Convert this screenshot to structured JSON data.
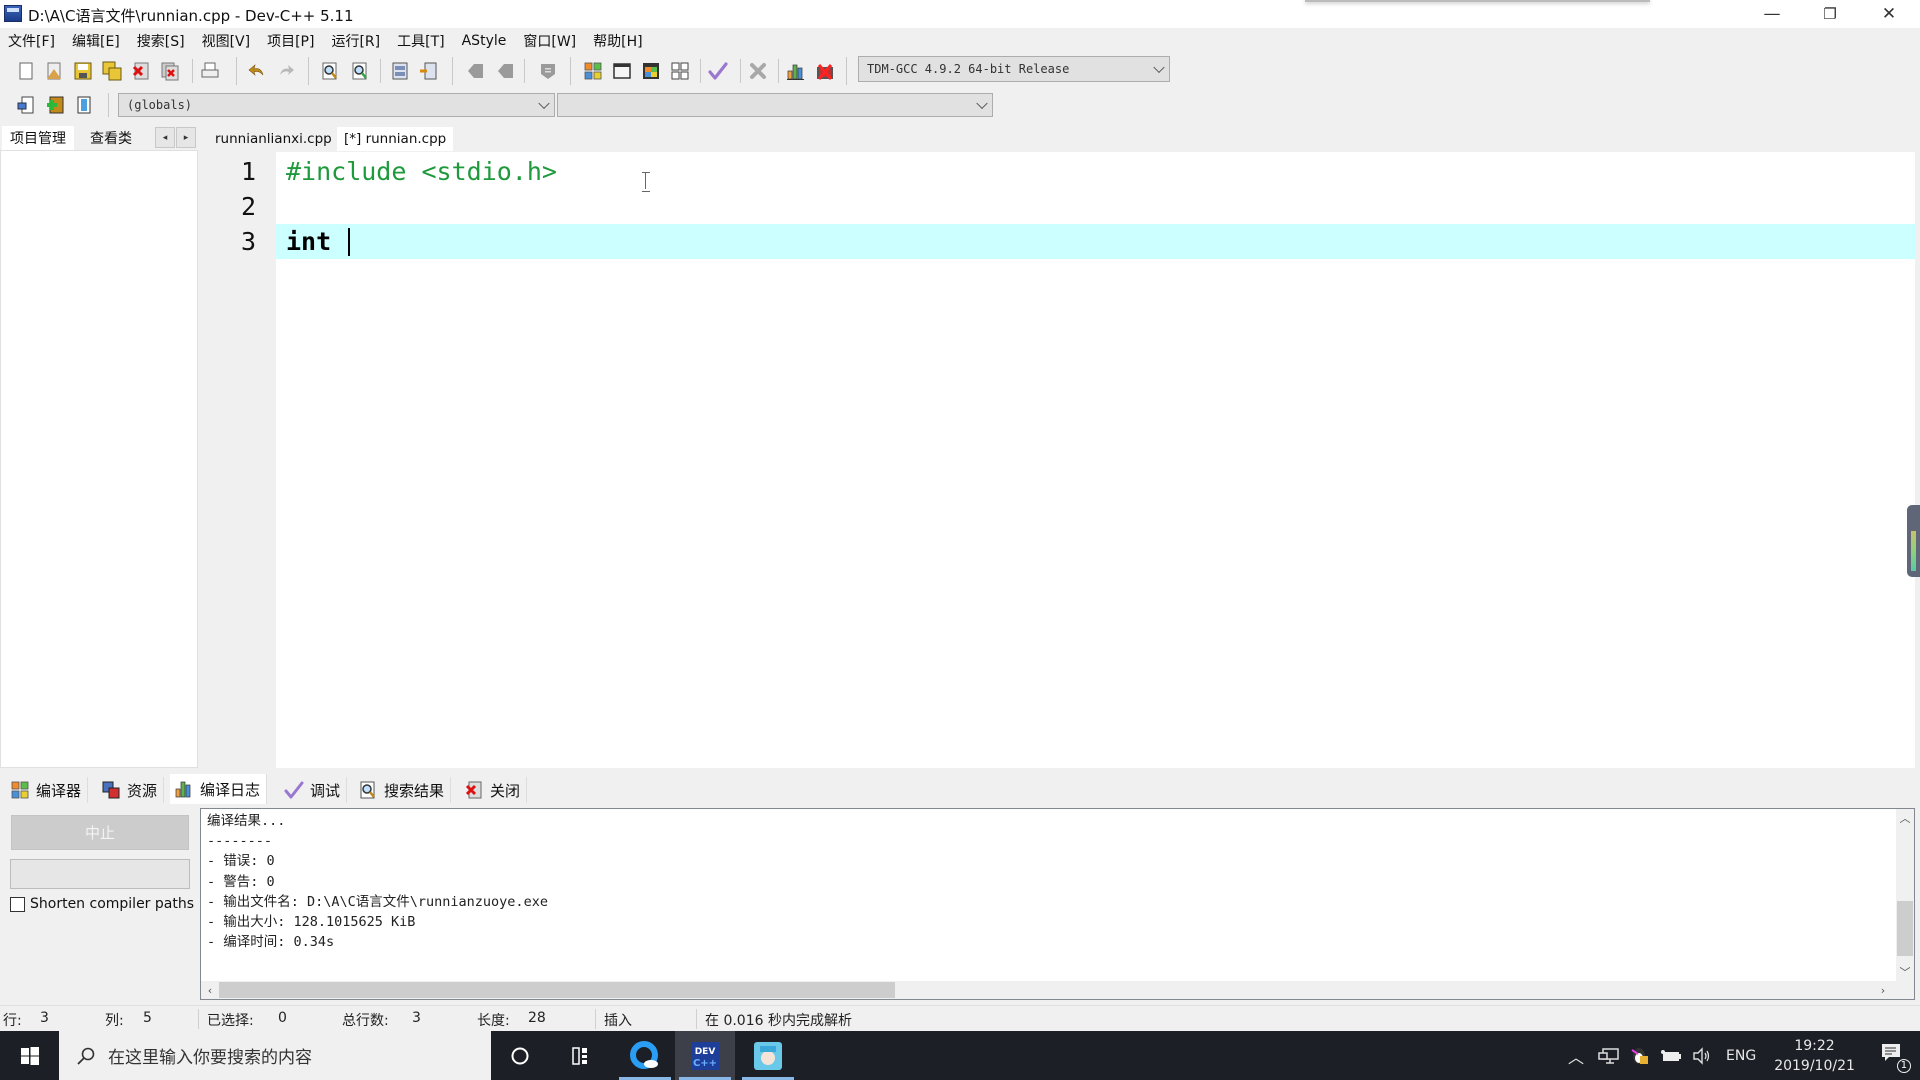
{
  "window": {
    "title": "D:\\A\\C语言文件\\runnian.cpp - Dev-C++ 5.11",
    "minimize_glyph": "—",
    "restore_glyph": "❐",
    "close_glyph": "✕"
  },
  "menu": [
    "文件[F]",
    "编辑[E]",
    "搜索[S]",
    "视图[V]",
    "项目[P]",
    "运行[R]",
    "工具[T]",
    "AStyle",
    "窗口[W]",
    "帮助[H]"
  ],
  "toolbar": {
    "compiler": "TDM-GCC 4.9.2 64-bit Release",
    "scope": "(globals)",
    "symbol": ""
  },
  "left_tabs": [
    "项目管理",
    "查看类"
  ],
  "left_tab_arrows": [
    "◂",
    "▸"
  ],
  "editor_tabs": [
    {
      "label": "runnianlianxi.cpp",
      "active": false
    },
    {
      "label": "[*] runnian.cpp",
      "active": true
    }
  ],
  "editor": {
    "line_numbers": [
      "1",
      "2",
      "3"
    ],
    "lines": [
      {
        "text": "#include <stdio.h>",
        "kind": "preprocessor"
      },
      {
        "text": "",
        "kind": "plain"
      },
      {
        "text": "int ",
        "kind": "keyword",
        "current": true
      }
    ],
    "current_line_color": "#ccffff",
    "preprocessor_color": "#1e9a3c"
  },
  "bottom_tabs": [
    {
      "label": "编译器",
      "icon": "compiler-icon"
    },
    {
      "label": "资源",
      "icon": "resources-icon"
    },
    {
      "label": "编译日志",
      "icon": "compile-log-icon",
      "active": true
    },
    {
      "label": "调试",
      "icon": "debug-icon"
    },
    {
      "label": "搜索结果",
      "icon": "search-results-icon"
    },
    {
      "label": "关闭",
      "icon": "close-panel-icon"
    }
  ],
  "bottom_left": {
    "abort_label": "中止",
    "shorten_label": "Shorten compiler paths",
    "shorten_checked": false
  },
  "log": {
    "lines": [
      "编译结果...",
      "--------",
      "- 错误: 0",
      "- 警告: 0",
      "- 输出文件名: D:\\A\\C语言文件\\runnianzuoye.exe",
      "- 输出大小: 128.1015625 KiB",
      "- 编译时间: 0.34s"
    ]
  },
  "status": {
    "row_label": "行:",
    "row": "3",
    "col_label": "列:",
    "col": "5",
    "sel_label": "已选择:",
    "sel": "0",
    "total_label": "总行数:",
    "total": "3",
    "len_label": "长度:",
    "len": "28",
    "mode": "插入",
    "parse": "在 0.016 秒内完成解析"
  },
  "taskbar": {
    "search_placeholder": "在这里输入你要搜索的内容",
    "apps": [
      "cortana",
      "task-view",
      "qq-browser",
      "dev-cpp",
      "anime-app"
    ],
    "tray": {
      "lang": "ENG",
      "time": "19:22",
      "date": "2019/10/21",
      "notifications": "1"
    }
  }
}
